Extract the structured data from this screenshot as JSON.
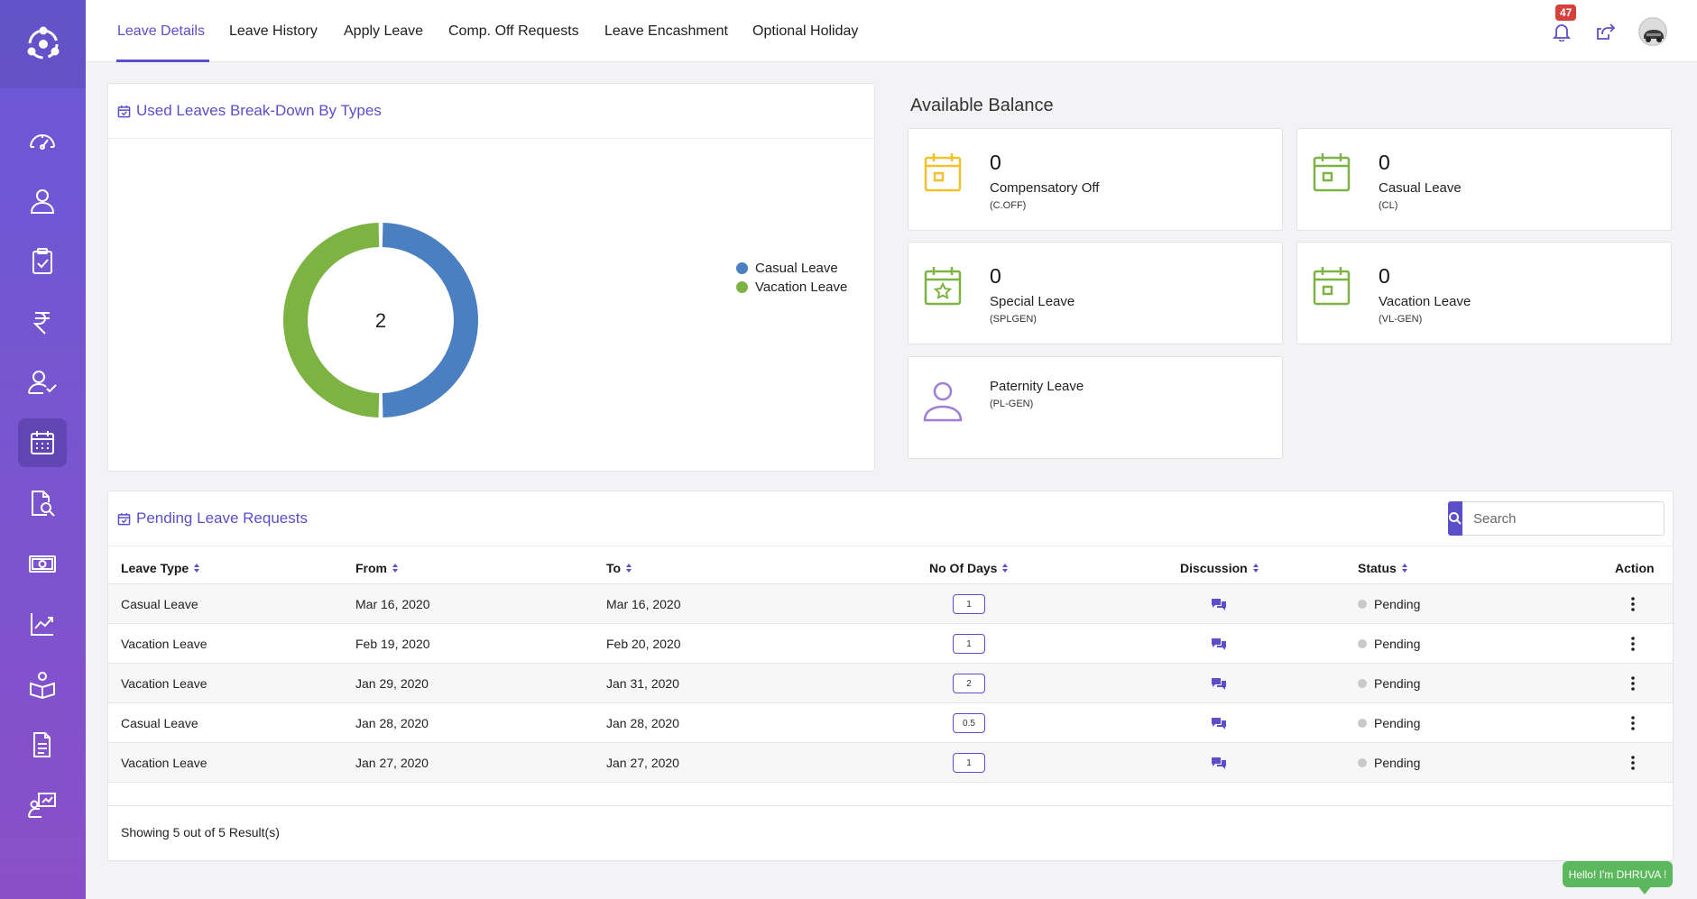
{
  "sidebar": {
    "logo": "app-logo",
    "items": [
      {
        "icon": "dashboard-gauge-icon"
      },
      {
        "icon": "user-icon"
      },
      {
        "icon": "clipboard-check-icon"
      },
      {
        "icon": "rupee-icon"
      },
      {
        "icon": "user-check-icon"
      },
      {
        "icon": "calendar-icon",
        "active": true
      },
      {
        "icon": "document-search-icon"
      },
      {
        "icon": "money-icon"
      },
      {
        "icon": "chart-trend-icon"
      },
      {
        "icon": "book-user-icon"
      },
      {
        "icon": "document-icon"
      },
      {
        "icon": "presentation-icon"
      }
    ]
  },
  "topbar": {
    "tabs": [
      "Leave Details",
      "Leave History",
      "Apply Leave",
      "Comp. Off Requests",
      "Leave Encashment",
      "Optional Holiday"
    ],
    "active_tab": "Leave Details",
    "notification_count": "47"
  },
  "chart_card": {
    "title": "Used Leaves Break-Down By Types"
  },
  "chart_data": {
    "type": "pie",
    "total_label": "2",
    "series": [
      {
        "name": "Casual Leave",
        "value": 1,
        "color": "#4a7fc1"
      },
      {
        "name": "Vacation Leave",
        "value": 1,
        "color": "#7cb342"
      }
    ]
  },
  "balance": {
    "title": "Available Balance",
    "items": [
      {
        "count": "0",
        "name": "Compensatory Off",
        "code": "(C.OFF)",
        "color": "#f2c12e",
        "icon": "calendar-icon"
      },
      {
        "count": "0",
        "name": "Casual Leave",
        "code": "(CL)",
        "color": "#7cb342",
        "icon": "calendar-icon"
      },
      {
        "count": "0",
        "name": "Special Leave",
        "code": "(SPLGEN)",
        "color": "#7cb342",
        "icon": "calendar-star-icon"
      },
      {
        "count": "0",
        "name": "Vacation Leave",
        "code": "(VL-GEN)",
        "color": "#7cb342",
        "icon": "calendar-icon"
      },
      {
        "count": "",
        "name": "Paternity Leave",
        "code": "(PL-GEN)",
        "color": "#9d7fd6",
        "icon": "person-icon"
      }
    ]
  },
  "pending": {
    "title": "Pending Leave Requests",
    "search_placeholder": "Search",
    "columns": [
      "Leave Type",
      "From",
      "To",
      "No Of Days",
      "Discussion",
      "Status",
      "Action"
    ],
    "rows": [
      {
        "type": "Casual Leave",
        "from": "Mar 16, 2020",
        "to": "Mar 16, 2020",
        "days": "1",
        "status": "Pending"
      },
      {
        "type": "Vacation Leave",
        "from": "Feb 19, 2020",
        "to": "Feb 20, 2020",
        "days": "1",
        "status": "Pending"
      },
      {
        "type": "Vacation Leave",
        "from": "Jan 29, 2020",
        "to": "Jan 31, 2020",
        "days": "2",
        "status": "Pending"
      },
      {
        "type": "Casual Leave",
        "from": "Jan 28, 2020",
        "to": "Jan 28, 2020",
        "days": "0.5",
        "status": "Pending"
      },
      {
        "type": "Vacation Leave",
        "from": "Jan 27, 2020",
        "to": "Jan 27, 2020",
        "days": "1",
        "status": "Pending"
      }
    ],
    "footer": "Showing 5 out of 5 Result(s)"
  },
  "chat": {
    "label": "Hello! I'm DHRUVA !",
    "color": "#5cb85c"
  },
  "colors": {
    "accent": "#5b4fc9",
    "sidebar_top": "#6a58d6",
    "sidebar_bottom": "#8a4fc8"
  }
}
